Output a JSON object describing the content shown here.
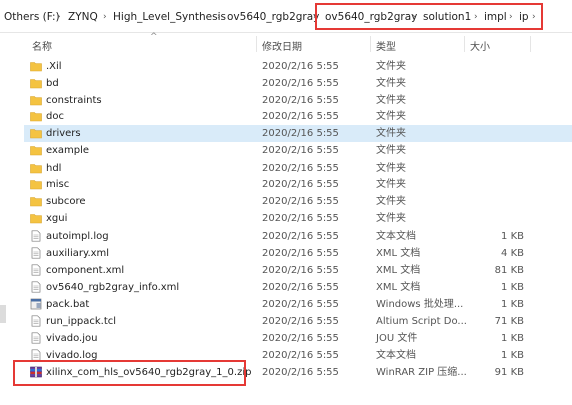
{
  "breadcrumb": [
    "Others (F:)",
    "ZYNQ",
    "High_Level_Synthesis",
    "ov5640_rgb2gray",
    "ov5640_rgb2gray",
    "solution1",
    "impl",
    "ip"
  ],
  "columns": {
    "name": "名称",
    "date": "修改日期",
    "type": "类型",
    "size": "大小"
  },
  "files": [
    {
      "name": ".Xil",
      "date": "2020/2/16 5:55",
      "type": "文件夹",
      "size": "",
      "icon": "folder-icon"
    },
    {
      "name": "bd",
      "date": "2020/2/16 5:55",
      "type": "文件夹",
      "size": "",
      "icon": "folder-icon"
    },
    {
      "name": "constraints",
      "date": "2020/2/16 5:55",
      "type": "文件夹",
      "size": "",
      "icon": "folder-icon"
    },
    {
      "name": "doc",
      "date": "2020/2/16 5:55",
      "type": "文件夹",
      "size": "",
      "icon": "folder-icon"
    },
    {
      "name": "drivers",
      "date": "2020/2/16 5:55",
      "type": "文件夹",
      "size": "",
      "icon": "folder-icon",
      "selected": true
    },
    {
      "name": "example",
      "date": "2020/2/16 5:55",
      "type": "文件夹",
      "size": "",
      "icon": "folder-icon"
    },
    {
      "name": "hdl",
      "date": "2020/2/16 5:55",
      "type": "文件夹",
      "size": "",
      "icon": "folder-icon"
    },
    {
      "name": "misc",
      "date": "2020/2/16 5:55",
      "type": "文件夹",
      "size": "",
      "icon": "folder-icon"
    },
    {
      "name": "subcore",
      "date": "2020/2/16 5:55",
      "type": "文件夹",
      "size": "",
      "icon": "folder-icon"
    },
    {
      "name": "xgui",
      "date": "2020/2/16 5:55",
      "type": "文件夹",
      "size": "",
      "icon": "folder-icon"
    },
    {
      "name": "autoimpl.log",
      "date": "2020/2/16 5:55",
      "type": "文本文档",
      "size": "1 KB",
      "icon": "text-file-icon"
    },
    {
      "name": "auxiliary.xml",
      "date": "2020/2/16 5:55",
      "type": "XML 文档",
      "size": "4 KB",
      "icon": "text-file-icon"
    },
    {
      "name": "component.xml",
      "date": "2020/2/16 5:55",
      "type": "XML 文档",
      "size": "81 KB",
      "icon": "text-file-icon"
    },
    {
      "name": "ov5640_rgb2gray_info.xml",
      "date": "2020/2/16 5:55",
      "type": "XML 文档",
      "size": "1 KB",
      "icon": "text-file-icon"
    },
    {
      "name": "pack.bat",
      "date": "2020/2/16 5:55",
      "type": "Windows 批处理...",
      "size": "1 KB",
      "icon": "batch-file-icon"
    },
    {
      "name": "run_ippack.tcl",
      "date": "2020/2/16 5:55",
      "type": "Altium Script Do...",
      "size": "71 KB",
      "icon": "text-file-icon"
    },
    {
      "name": "vivado.jou",
      "date": "2020/2/16 5:55",
      "type": "JOU 文件",
      "size": "1 KB",
      "icon": "text-file-icon"
    },
    {
      "name": "vivado.log",
      "date": "2020/2/16 5:55",
      "type": "文本文档",
      "size": "1 KB",
      "icon": "text-file-icon"
    },
    {
      "name": "xilinx_com_hls_ov5640_rgb2gray_1_0.zip",
      "date": "2020/2/16 5:55",
      "type": "WinRAR ZIP 压缩...",
      "size": "91 KB",
      "icon": "zip-archive-icon"
    }
  ],
  "colors": {
    "highlight": "#e53935",
    "selected_row": "#d9ebf9",
    "folder": "#f4c342"
  }
}
